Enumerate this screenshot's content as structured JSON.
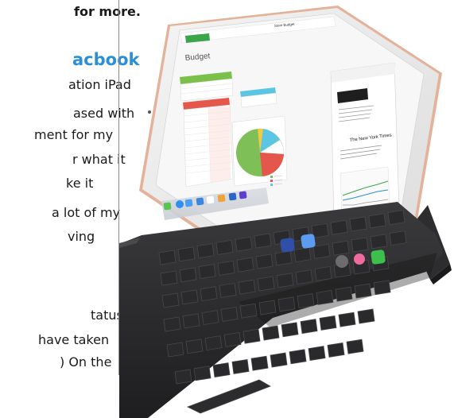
{
  "article": {
    "lines": [
      "for more.",
      "acbook",
      "ation iPad",
      "ased with",
      "ment for my",
      "r what it",
      "ke it",
      "a lot of my",
      "ving",
      "tatus",
      "have taken",
      ") On the"
    ]
  },
  "ipad_screen": {
    "doc_title": "Budget",
    "toolbar_title": "Store Budget",
    "nyt_masthead": "The New York Times"
  }
}
